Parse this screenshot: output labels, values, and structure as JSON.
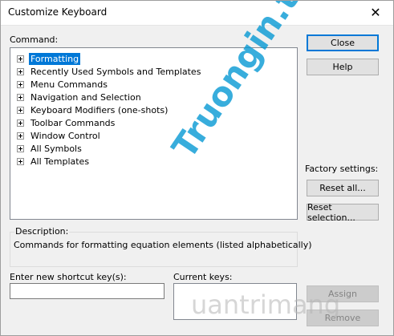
{
  "window": {
    "title": "Customize Keyboard",
    "close_glyph": "✕"
  },
  "command_label": "Command:",
  "tree_items": [
    "Formatting",
    "Recently Used Symbols and Templates",
    "Menu Commands",
    "Navigation and Selection",
    "Keyboard Modifiers (one-shots)",
    "Toolbar Commands",
    "Window Control",
    "All Symbols",
    "All Templates"
  ],
  "selected_index": 0,
  "buttons": {
    "close": "Close",
    "help": "Help",
    "reset_all": "Reset all...",
    "reset_selection": "Reset selection...",
    "assign": "Assign",
    "remove": "Remove"
  },
  "factory_settings_label": "Factory settings:",
  "description": {
    "legend": "Description:",
    "text": "Commands for formatting equation elements  (listed alphabetically)"
  },
  "shortcut_label": "Enter new shortcut key(s):",
  "current_keys_label": "Current keys:",
  "watermark": {
    "brand": "Truongin.top",
    "brand2": "uantrimang"
  },
  "colors": {
    "selection": "#0078d7",
    "watermark": "#0096d2"
  }
}
